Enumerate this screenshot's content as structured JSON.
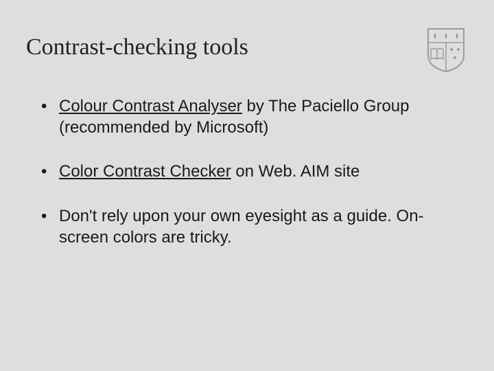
{
  "title": "Contrast-checking tools",
  "bullets": [
    {
      "link": "Colour Contrast Analyser",
      "rest": " by The Paciello Group (recommended by Microsoft)"
    },
    {
      "link": "Color Contrast Checker",
      "rest": " on Web. AIM site"
    },
    {
      "link": "",
      "rest": "Don't rely upon your own eyesight as a guide. On-screen colors are tricky."
    }
  ],
  "logo_name": "university-shield-icon"
}
